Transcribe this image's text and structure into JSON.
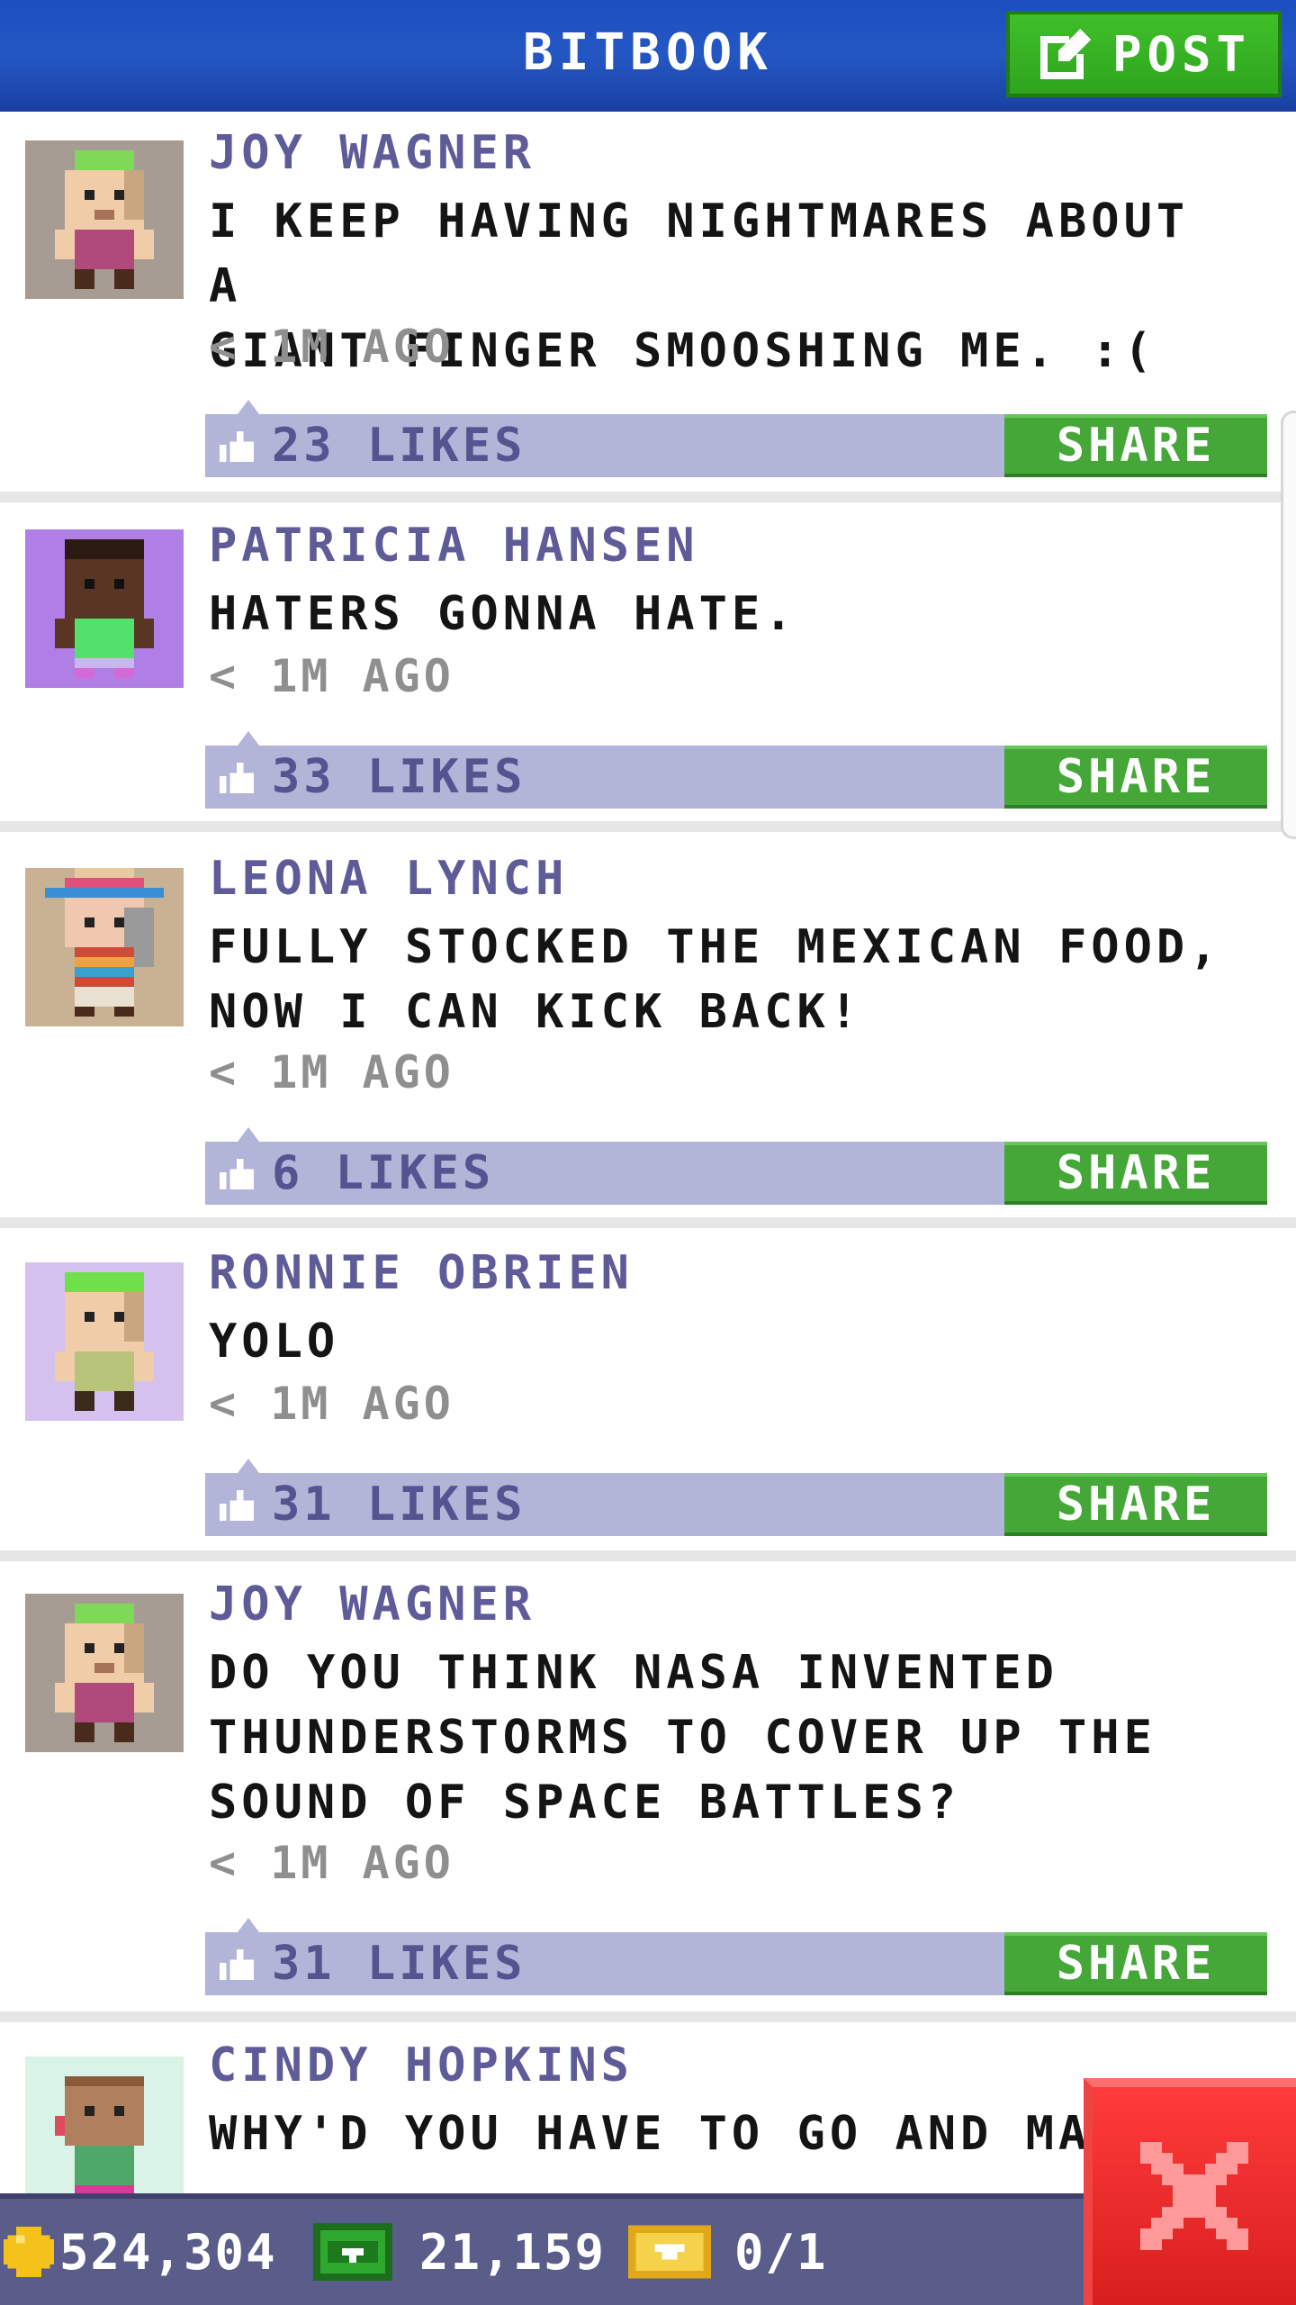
{
  "header": {
    "title": "BITBOOK",
    "post_label": "POST"
  },
  "posts": [
    {
      "name": "JOY WAGNER",
      "text": "I KEEP HAVING NIGHTMARES ABOUT A\nGIANT FINGER SMOOSHING ME. :(",
      "time": "< 1M AGO",
      "likes": "23 LIKES",
      "share": "SHARE"
    },
    {
      "name": "PATRICIA HANSEN",
      "text": "HATERS GONNA HATE.",
      "time": "< 1M AGO",
      "likes": "33 LIKES",
      "share": "SHARE"
    },
    {
      "name": "LEONA LYNCH",
      "text": "FULLY STOCKED THE MEXICAN FOOD,\nNOW I CAN KICK BACK!",
      "time": "< 1M AGO",
      "likes": "6 LIKES",
      "share": "SHARE"
    },
    {
      "name": "RONNIE OBRIEN",
      "text": "YOLO",
      "time": "< 1M AGO",
      "likes": "31 LIKES",
      "share": "SHARE"
    },
    {
      "name": "JOY WAGNER",
      "text": "DO YOU THINK NASA INVENTED\nTHUNDERSTORMS TO COVER UP THE\nSOUND OF SPACE BATTLES?",
      "time": "< 1M AGO",
      "likes": "31 LIKES",
      "share": "SHARE"
    },
    {
      "name": "CINDY HOPKINS",
      "text": "WHY'D YOU HAVE TO GO AND MA"
    }
  ],
  "footer": {
    "coins": "524,304",
    "bux": "21,159",
    "tickets": "0/1"
  },
  "colors": {
    "header_blue": "#2457c4",
    "share_green": "#44a737",
    "like_bar": "#b2b4d8",
    "name_purple": "#5f5b98",
    "close_red": "#e52525"
  },
  "icons": [
    "edit-icon",
    "like-icon",
    "coin-icon",
    "cash-icon",
    "ticket-icon",
    "close-icon"
  ]
}
